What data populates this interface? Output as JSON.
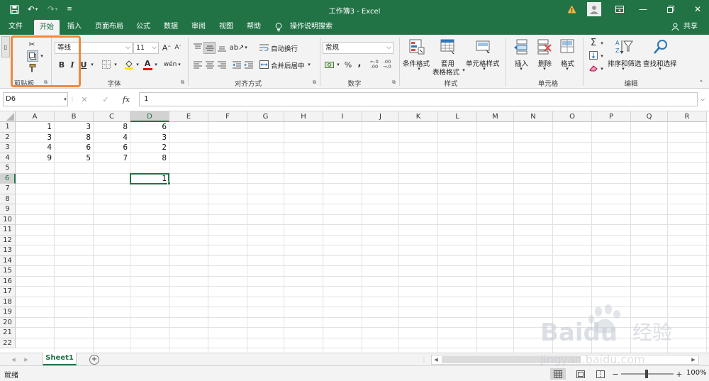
{
  "titlebar": {
    "title": "工作簿3  -  Excel",
    "warning_icon": "warning-icon",
    "account_icon": "account-icon",
    "ribbon_display_icon": "ribbon-display-icon",
    "minimize_icon": "minimize-icon",
    "restore_icon": "restore-icon",
    "close_icon": "close-icon"
  },
  "tabs": [
    {
      "label": "文件"
    },
    {
      "label": "开始"
    },
    {
      "label": "插入"
    },
    {
      "label": "页面布局"
    },
    {
      "label": "公式"
    },
    {
      "label": "数据"
    },
    {
      "label": "审阅"
    },
    {
      "label": "视图"
    },
    {
      "label": "帮助"
    }
  ],
  "tell_me": "操作说明搜索",
  "share": "共享",
  "ribbon": {
    "clipboard": {
      "label": "剪贴板",
      "paste": "粘贴"
    },
    "font": {
      "label": "字体",
      "font_name": "等线",
      "font_size": "11",
      "grow": "A",
      "shrink": "A",
      "bold": "B",
      "italic": "I",
      "underline": "U",
      "font_color_letter": "A",
      "phonetic": "wén"
    },
    "alignment": {
      "label": "对齐方式",
      "wrap_text": "自动换行",
      "merge_center": "合并后居中"
    },
    "number": {
      "label": "数字",
      "format": "常规",
      "percent": "%",
      "comma": ","
    },
    "styles": {
      "label": "样式",
      "conditional": "条件格式",
      "table_format_line1": "套用",
      "table_format_line2": "表格格式",
      "cell_styles": "单元格样式"
    },
    "cells": {
      "label": "单元格",
      "insert": "插入",
      "delete": "删除",
      "format": "格式"
    },
    "editing": {
      "label": "编辑",
      "sort_filter": "排序和筛选",
      "find_select": "查找和选择",
      "sum": "Σ"
    }
  },
  "formula_bar": {
    "name_box": "D6",
    "fx": "fx",
    "content": "1",
    "cancel": "✕",
    "enter": "✓"
  },
  "grid": {
    "columns": [
      "A",
      "B",
      "C",
      "D",
      "E",
      "F",
      "G",
      "H",
      "I",
      "J",
      "K",
      "L",
      "M",
      "N",
      "O",
      "P",
      "Q",
      "R"
    ],
    "rows": [
      "1",
      "2",
      "3",
      "4",
      "5",
      "6",
      "7",
      "8",
      "9",
      "10",
      "11",
      "12",
      "13",
      "14",
      "15",
      "16",
      "17",
      "18",
      "19",
      "20",
      "21",
      "22"
    ],
    "data": [
      [
        1,
        3,
        8,
        6
      ],
      [
        3,
        8,
        4,
        3
      ],
      [
        4,
        6,
        6,
        2
      ],
      [
        9,
        5,
        7,
        8
      ]
    ],
    "d6": "1",
    "selected_col": "D",
    "selected_row": "6"
  },
  "sheets": [
    {
      "name": "Sheet1"
    }
  ],
  "status": {
    "ready": "就绪",
    "zoom": "100%"
  },
  "watermark": {
    "brand": "Baidu",
    "brand_cn": "经验",
    "url": "jingyan.baidu.com"
  },
  "colors": {
    "excel_green": "#217346",
    "highlight": "#f0883e",
    "header_gray": "#f3f3f3"
  }
}
